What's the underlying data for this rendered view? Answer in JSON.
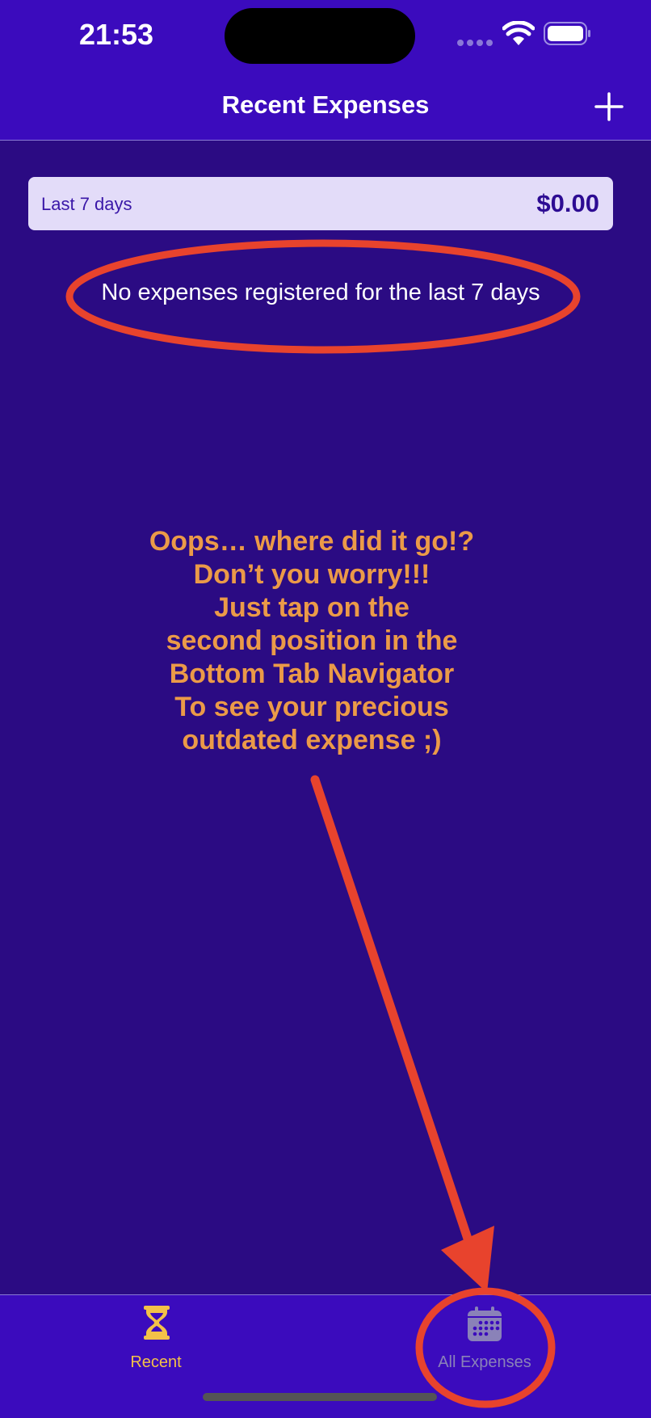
{
  "status_bar": {
    "time": "21:53"
  },
  "header": {
    "title": "Recent Expenses",
    "add_icon": "plus-icon"
  },
  "summary": {
    "period_label": "Last 7 days",
    "total": "$0.00"
  },
  "empty_message": "No expenses registered for the last 7 days",
  "annotation": {
    "lines": [
      "Oops… where did it go!?",
      "Don’t you worry!!!",
      "Just tap on the",
      "second position in the",
      "Bottom Tab Navigator",
      "To see your precious",
      "outdated expense ;)"
    ]
  },
  "tabs": [
    {
      "label": "Recent",
      "icon": "hourglass-icon",
      "active": true
    },
    {
      "label": "All Expenses",
      "icon": "calendar-icon",
      "active": false
    }
  ],
  "colors": {
    "header_bg": "#3b0bbd",
    "body_bg": "#2b0b83",
    "active_tab": "#f3c148",
    "annotation_text": "#eb9a48",
    "annotation_marks": "#e8432d"
  }
}
